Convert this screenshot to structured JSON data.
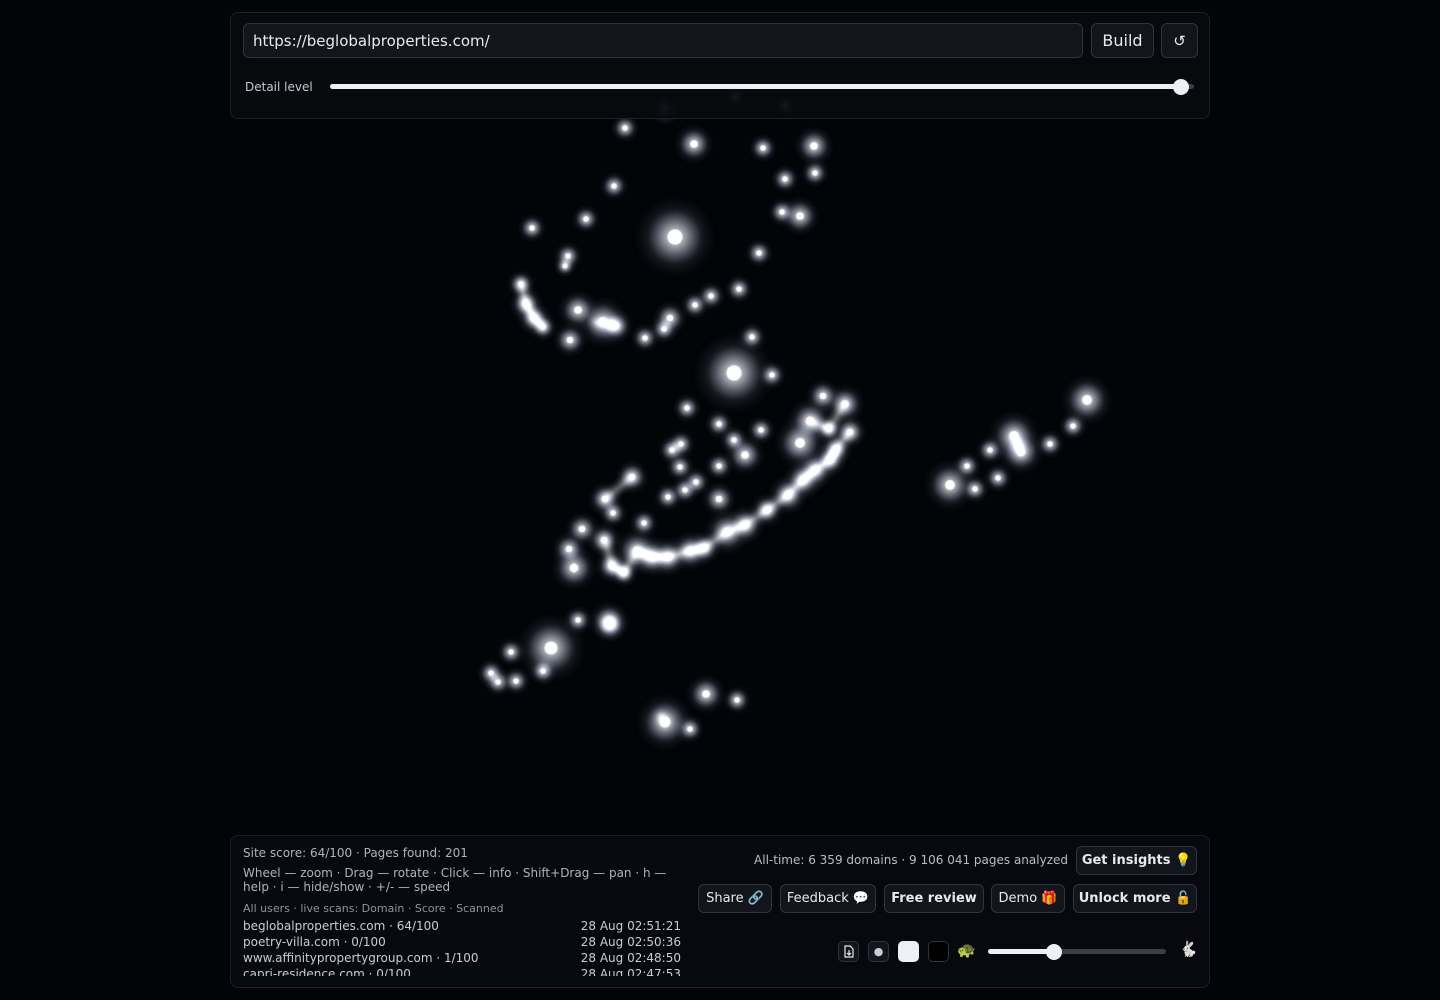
{
  "toolbar": {
    "url_value": "https://beglobalproperties.com/",
    "build_label": "Build",
    "reset_label": "↺",
    "detail_label": "Detail level",
    "detail_level": 0.985
  },
  "stats": {
    "site_score": "Site score: 64/100 · Pages found: 201",
    "help": "Wheel — zoom · Drag — rotate · Click — info · Shift+Drag — pan · h — help · i — hide/show · +/- — speed",
    "all_time": "All-time: 6 359 domains · 9 106 041 pages analyzed"
  },
  "live_scans": {
    "header": "All users · live scans: Domain · Score · Scanned",
    "rows": [
      {
        "domain": "beglobalproperties.com · 64/100",
        "time": "28 Aug 02:51:21"
      },
      {
        "domain": "poetry-villa.com · 0/100",
        "time": "28 Aug 02:50:36"
      },
      {
        "domain": "www.affinitypropertygroup.com · 1/100",
        "time": "28 Aug 02:48:50"
      },
      {
        "domain": "capri-residence.com · 0/100",
        "time": "28 Aug 02:47:53"
      }
    ]
  },
  "actions": {
    "insights": "Get insights 💡",
    "share": "Share 🔗",
    "feedback": "Feedback 💬",
    "free_review": "Free review",
    "demo": "Demo 🎁",
    "unlock": "Unlock more 🔓"
  },
  "controls": {
    "download_icon": "download-icon",
    "dot_icon": "dot-icon",
    "turtle": "🐢",
    "rabbit": "🐇",
    "speed": 0.37
  },
  "colors": {
    "background": "#030408",
    "node": "#ffffff"
  }
}
